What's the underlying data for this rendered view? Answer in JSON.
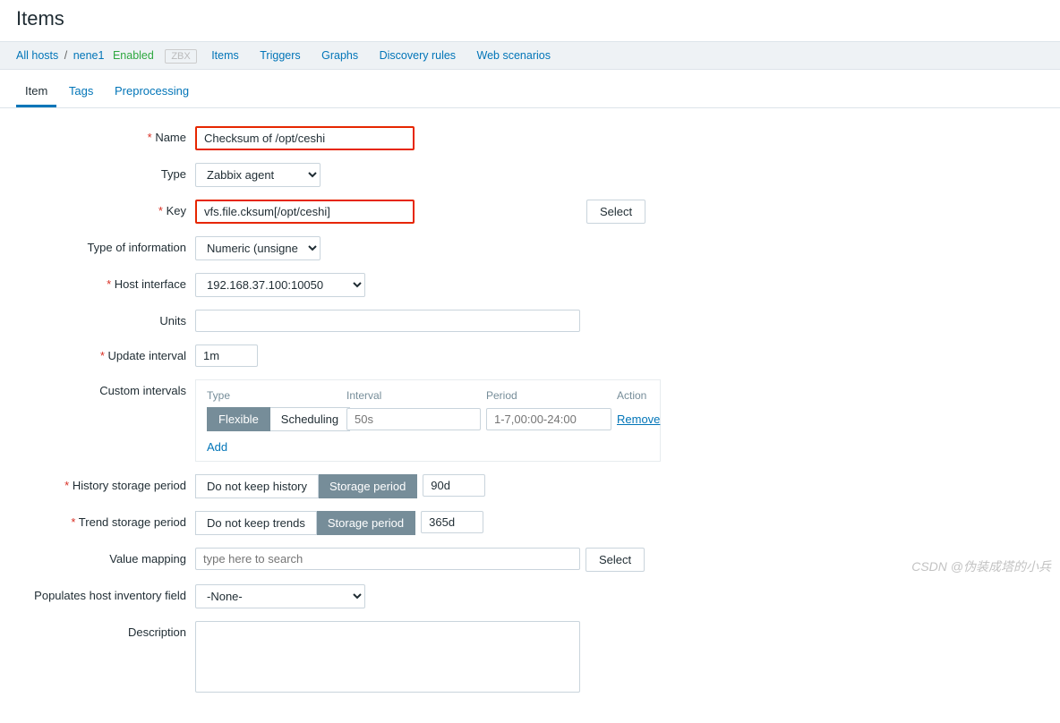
{
  "page_title": "Items",
  "breadcrumb": {
    "all_hosts": "All hosts",
    "host": "nene1",
    "enabled": "Enabled",
    "zbx": "ZBX"
  },
  "nav": {
    "items": "Items",
    "triggers": "Triggers",
    "graphs": "Graphs",
    "discovery": "Discovery rules",
    "web": "Web scenarios"
  },
  "tabs": {
    "item": "Item",
    "tags": "Tags",
    "preprocessing": "Preprocessing"
  },
  "form": {
    "name_label": "Name",
    "name_value": "Checksum of /opt/ceshi",
    "type_label": "Type",
    "type_value": "Zabbix agent",
    "key_label": "Key",
    "key_value": "vfs.file.cksum[/opt/ceshi]",
    "select_btn": "Select",
    "info_label": "Type of information",
    "info_value": "Numeric (unsigned)",
    "hostif_label": "Host interface",
    "hostif_value": "192.168.37.100:10050",
    "units_label": "Units",
    "units_value": "",
    "update_label": "Update interval",
    "update_value": "1m",
    "custom_label": "Custom intervals",
    "ci_type": "Type",
    "ci_interval": "Interval",
    "ci_period": "Period",
    "ci_action": "Action",
    "ci_flexible": "Flexible",
    "ci_scheduling": "Scheduling",
    "ci_interval_ph": "50s",
    "ci_period_ph": "1-7,00:00-24:00",
    "ci_remove": "Remove",
    "ci_add": "Add",
    "history_label": "History storage period",
    "history_nokeep": "Do not keep history",
    "history_period_btn": "Storage period",
    "history_value": "90d",
    "trend_label": "Trend storage period",
    "trend_nokeep": "Do not keep trends",
    "trend_period_btn": "Storage period",
    "trend_value": "365d",
    "valuemap_label": "Value mapping",
    "valuemap_ph": "type here to search",
    "inventory_label": "Populates host inventory field",
    "inventory_value": "-None-",
    "desc_label": "Description",
    "desc_value": ""
  },
  "watermark": "CSDN @伪装成塔的小兵"
}
